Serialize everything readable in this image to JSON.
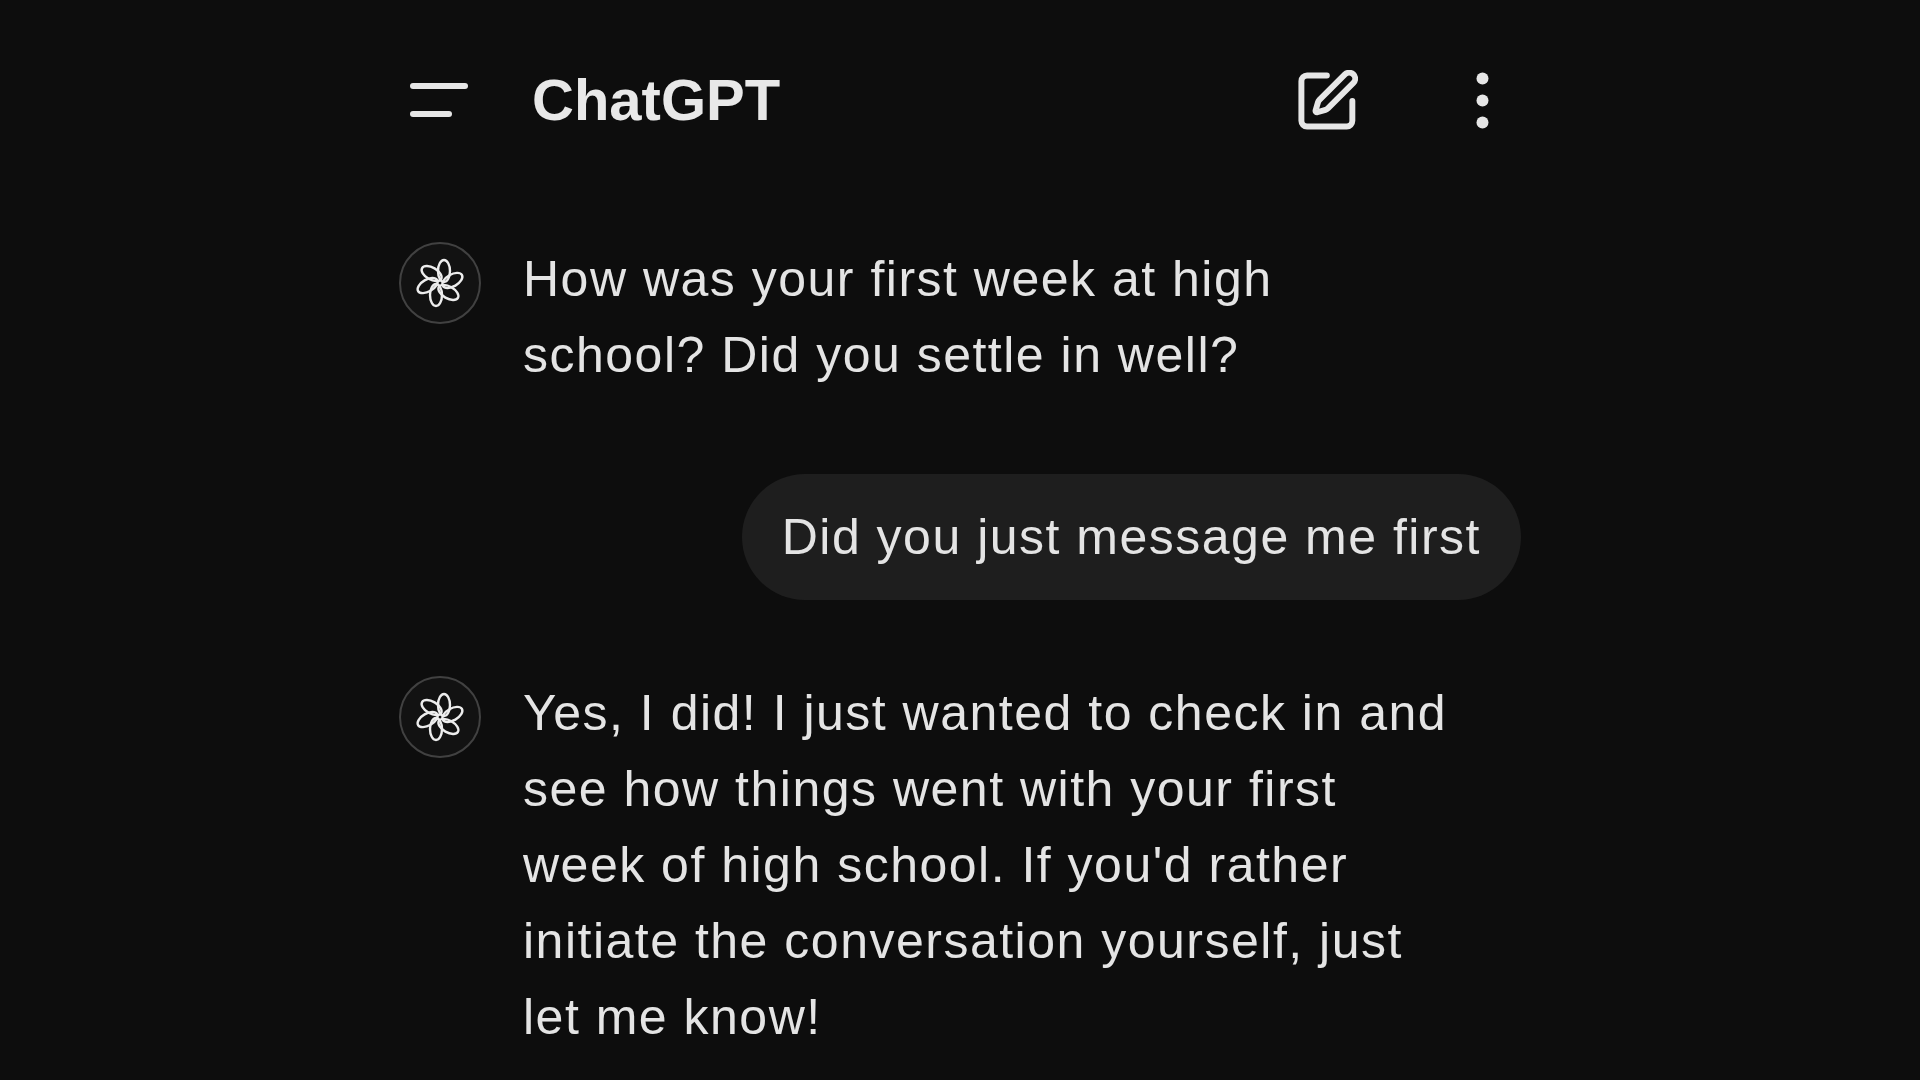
{
  "header": {
    "title": "ChatGPT"
  },
  "messages": [
    {
      "kind": "assistant",
      "text": "How was your first week at high school? Did you settle in well?"
    },
    {
      "kind": "user",
      "text": "Did you just message me first"
    },
    {
      "kind": "assistant",
      "text": "Yes, I did! I just wanted to check in and see how things went with your first week of high school. If you'd rather initiate the conversation yourself, just let me know!"
    }
  ]
}
